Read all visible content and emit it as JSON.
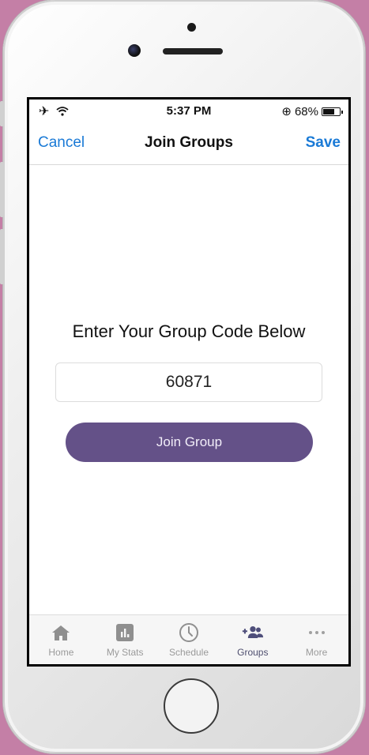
{
  "status_bar": {
    "time": "5:37 PM",
    "battery_text": "68%",
    "battery_level": 0.68,
    "lock_symbol": "⊕"
  },
  "nav": {
    "cancel_label": "Cancel",
    "title": "Join Groups",
    "save_label": "Save"
  },
  "main": {
    "prompt": "Enter Your Group Code Below",
    "code_value": "60871",
    "join_button_label": "Join Group"
  },
  "tabs": [
    {
      "label": "Home",
      "icon": "home-icon",
      "active": false
    },
    {
      "label": "My Stats",
      "icon": "bar-chart-icon",
      "active": false
    },
    {
      "label": "Schedule",
      "icon": "clock-icon",
      "active": false
    },
    {
      "label": "Groups",
      "icon": "add-group-icon",
      "active": true
    },
    {
      "label": "More",
      "icon": "more-dots-icon",
      "active": false
    }
  ],
  "colors": {
    "accent_blue": "#1a7ad6",
    "button_purple": "#645188",
    "background_pink": "#c47fa6"
  }
}
